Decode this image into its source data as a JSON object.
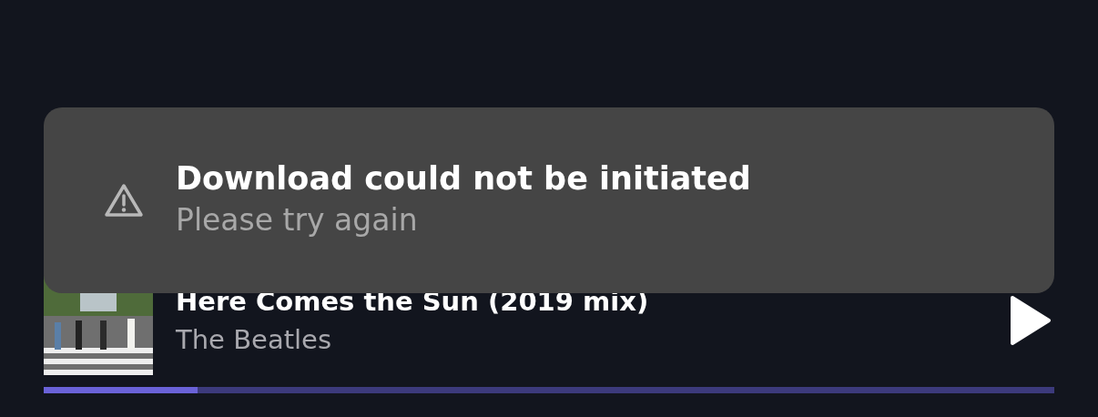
{
  "toast": {
    "title": "Download could not be initiated",
    "message": "Please try again"
  },
  "player": {
    "track": "Here Comes the Sun (2019 mix)",
    "artist": "The Beatles",
    "playing": false,
    "progress": {
      "level": 0.152
    }
  }
}
